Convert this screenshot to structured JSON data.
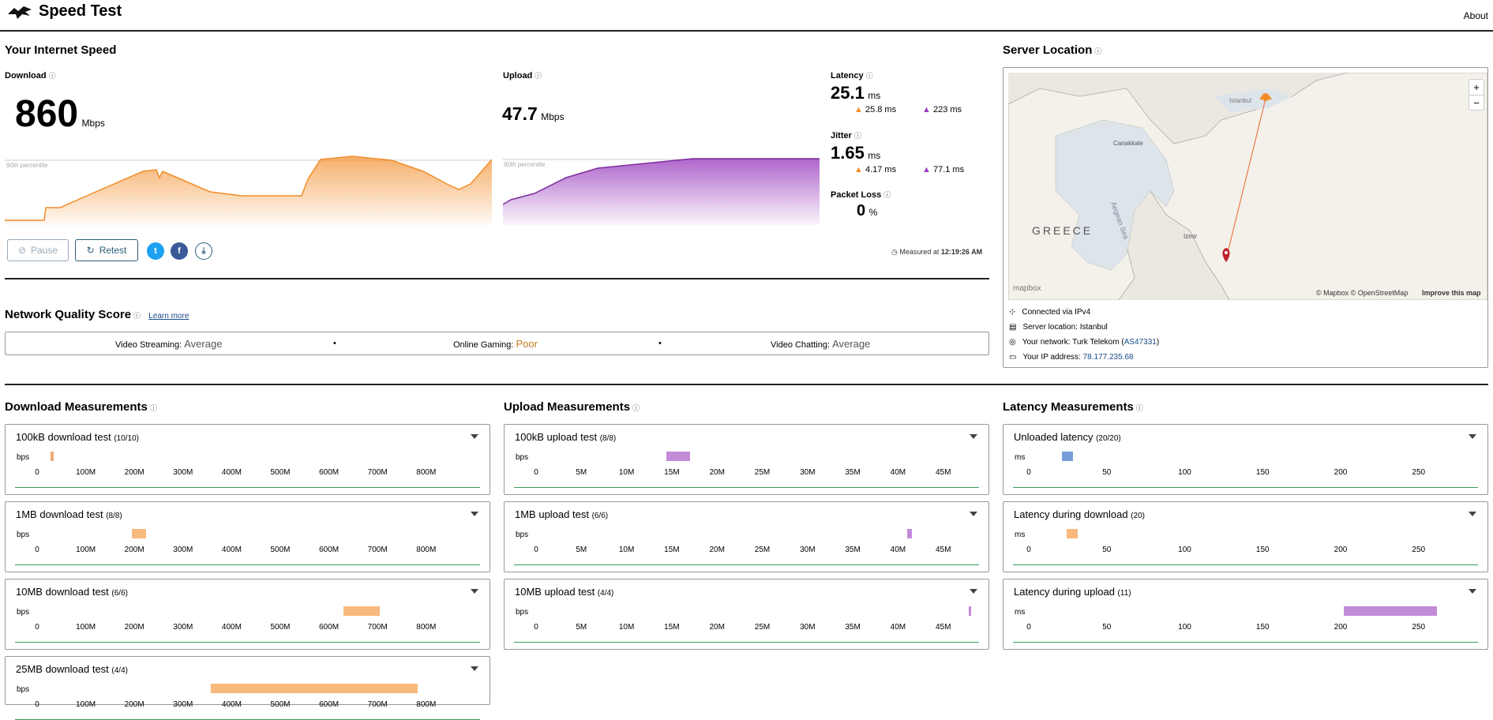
{
  "header": {
    "title": "Speed Test",
    "about": "About"
  },
  "speed": {
    "title": "Your Internet Speed",
    "download": {
      "label": "Download",
      "value": "860",
      "unit": "Mbps",
      "percentile": "90th percentile"
    },
    "upload": {
      "label": "Upload",
      "value": "47.7",
      "unit": "Mbps",
      "percentile": "90th percentile"
    },
    "latency": {
      "label": "Latency",
      "value": "25.1",
      "unit": "ms",
      "down": "25.8 ms",
      "up": "223 ms"
    },
    "jitter": {
      "label": "Jitter",
      "value": "1.65",
      "unit": "ms",
      "down": "4.17 ms",
      "up": "77.1 ms"
    },
    "loss": {
      "label": "Packet Loss",
      "value": "0",
      "unit": "%"
    },
    "measured": "Measured at ",
    "measured_time": "12:19:26 AM",
    "buttons": {
      "pause": "Pause",
      "retest": "Retest"
    }
  },
  "server": {
    "title": "Server Location",
    "connected": "Connected via IPv4",
    "location": "Server location: Istanbul",
    "network_prefix": "Your network: Turk Telekom (",
    "network_as": "AS47331",
    "network_suffix": ")",
    "ip_prefix": "Your IP address: ",
    "ip": "78.177.235.68",
    "map": {
      "istanbul": "Istanbul",
      "canakkale": "Canakkale",
      "greece": "GREECE",
      "sea": "Aegean Sea",
      "izmir": "Izmir",
      "attribution": "© Mapbox © OpenStreetMap",
      "improve": "Improve this map",
      "mapbox": "mapbox",
      "zoom_in": "+",
      "zoom_out": "−"
    }
  },
  "quality": {
    "title": "Network Quality Score",
    "learn": "Learn more",
    "items": [
      {
        "label": "Video Streaming:",
        "value": "Average"
      },
      {
        "label": "Online Gaming:",
        "value": "Poor"
      },
      {
        "label": "Video Chatting:",
        "value": "Average"
      }
    ],
    "sep": "•"
  },
  "measurements": {
    "download": {
      "title": "Download Measurements",
      "unit": "bps",
      "ticks": [
        "0",
        "100M",
        "200M",
        "300M",
        "400M",
        "500M",
        "600M",
        "700M",
        "800M"
      ],
      "tests": [
        {
          "name": "100kB download test",
          "count": "(10/10)"
        },
        {
          "name": "1MB download test",
          "count": "(8/8)"
        },
        {
          "name": "10MB download test",
          "count": "(6/6)"
        },
        {
          "name": "25MB download test",
          "count": "(4/4)"
        }
      ]
    },
    "upload": {
      "title": "Upload Measurements",
      "unit": "bps",
      "ticks": [
        "0",
        "5M",
        "10M",
        "15M",
        "20M",
        "25M",
        "30M",
        "35M",
        "40M",
        "45M"
      ],
      "tests": [
        {
          "name": "100kB upload test",
          "count": "(8/8)"
        },
        {
          "name": "1MB upload test",
          "count": "(6/6)"
        },
        {
          "name": "10MB upload test",
          "count": "(4/4)"
        }
      ]
    },
    "latency": {
      "title": "Latency Measurements",
      "unit": "ms",
      "ticks": [
        "0",
        "50",
        "100",
        "150",
        "200",
        "250"
      ],
      "tests": [
        {
          "name": "Unloaded latency",
          "count": "(20/20)"
        },
        {
          "name": "Latency during download",
          "count": "(20)"
        },
        {
          "name": "Latency during upload",
          "count": "(11)"
        }
      ]
    }
  },
  "colors": {
    "download": "#f28c28",
    "upload": "#9b3fbf",
    "latency": "#1f5fbf",
    "good": "#3a9a5b",
    "poor": "#c87a1a"
  }
}
